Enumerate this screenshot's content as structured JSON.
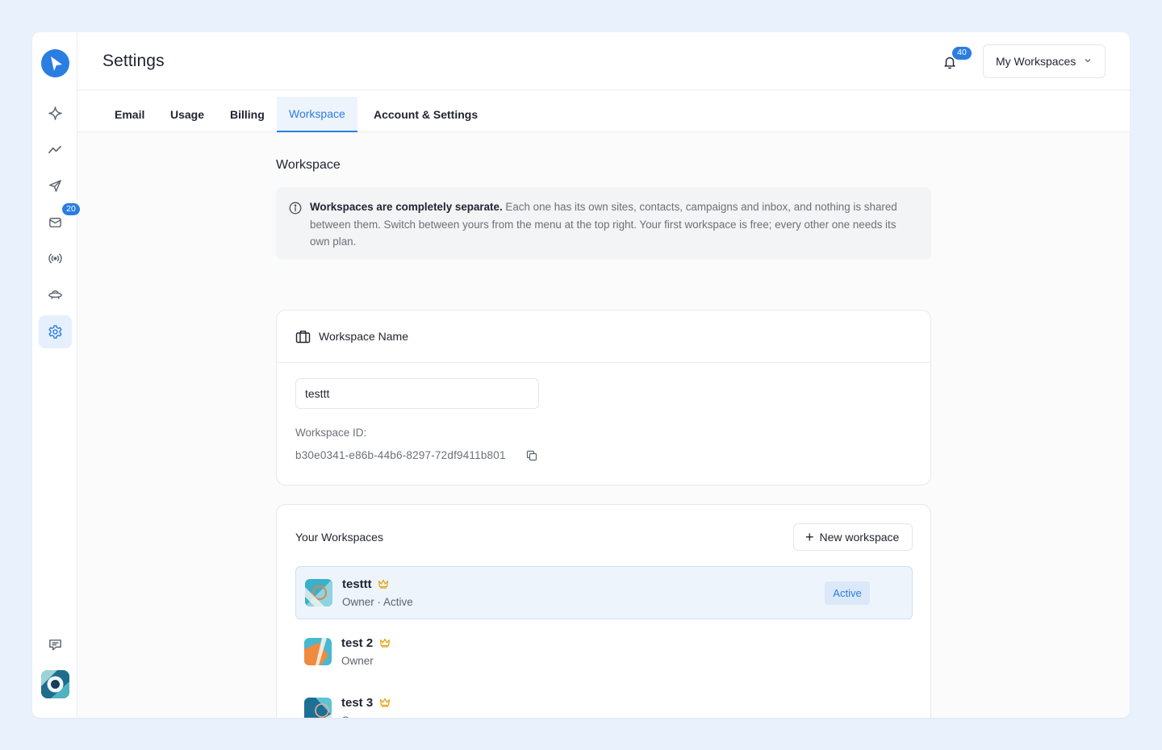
{
  "header": {
    "title": "Settings",
    "notification_count": "40",
    "workspace_selector": "My Workspaces"
  },
  "sidebar": {
    "items": [
      {
        "name": "sparkle-icon"
      },
      {
        "name": "analytics-icon"
      },
      {
        "name": "send-icon"
      },
      {
        "name": "inbox-icon",
        "badge": "20"
      },
      {
        "name": "broadcast-icon"
      },
      {
        "name": "ufo-icon"
      },
      {
        "name": "gear-icon",
        "active": true
      }
    ]
  },
  "tabs": [
    {
      "label": "Email"
    },
    {
      "label": "Usage"
    },
    {
      "label": "Billing"
    },
    {
      "label": "Workspace",
      "active": true
    },
    {
      "label": "Account & Settings"
    }
  ],
  "workspace_section": {
    "title": "Workspace",
    "info_bold": "Workspaces are completely separate.",
    "info_text": " Each one has its own sites, contacts, campaigns and inbox, and nothing is shared between them. Switch between yours from the menu at the top right. Your first workspace is free; every other one needs its own plan."
  },
  "name_card": {
    "title": "Workspace Name",
    "name_value": "testtt",
    "id_label": "Workspace ID:",
    "id_value": "b30e0341-e86b-44b6-8297-72df9411b801"
  },
  "workspaces_card": {
    "title": "Your Workspaces",
    "new_button": "New workspace",
    "items": [
      {
        "name": "testtt",
        "role": "Owner · Active",
        "badge": "Active",
        "active": true
      },
      {
        "name": "test 2",
        "role": "Owner"
      },
      {
        "name": "test 3",
        "role": "Owner"
      }
    ]
  },
  "colors": {
    "accent": "#2a7de1",
    "crown": "#e6a817",
    "background": "#e8f1fc"
  }
}
